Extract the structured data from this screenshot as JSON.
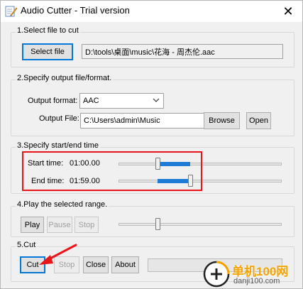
{
  "window": {
    "title": "Audio Cutter - Trial version",
    "icon": "pencil-app-icon",
    "close_glyph": "✕"
  },
  "section1": {
    "title": "1.Select file to cut",
    "select_button": "Select file",
    "file_path": "D:\\tools\\桌面\\music\\花海 - 周杰伦.aac"
  },
  "section2": {
    "title": "2.Specify output file/format.",
    "format_label": "Output format:",
    "format_value": "AAC",
    "file_label": "Output File:",
    "file_value": "C:\\Users\\admin\\Music",
    "browse_button": "Browse",
    "open_button": "Open"
  },
  "section3": {
    "title": "3.Specify start/end time",
    "start_label": "Start time:",
    "start_value": "01:00.00",
    "end_label": "End time:",
    "end_value": "01:59.00",
    "start_slider": {
      "thumb": 0.24,
      "range_start": 0.24,
      "range_end": 0.44
    },
    "end_slider": {
      "thumb": 0.44,
      "range_start": 0.24,
      "range_end": 0.44
    }
  },
  "section4": {
    "title": "4.Play the selected range.",
    "play_button": "Play",
    "pause_button": "Pause",
    "stop_button": "Stop",
    "slider": {
      "thumb": 0.24
    }
  },
  "section5": {
    "title": "5.Cut",
    "cut_button": "Cut",
    "stop_button": "Stop",
    "close_button": "Close",
    "about_button": "About"
  },
  "watermark": {
    "site_name": "单机100网",
    "site_url": "danji100.com"
  },
  "colors": {
    "highlight": "#e8151b",
    "slider_range": "#1e7bd6",
    "accent": "#0078d7"
  }
}
